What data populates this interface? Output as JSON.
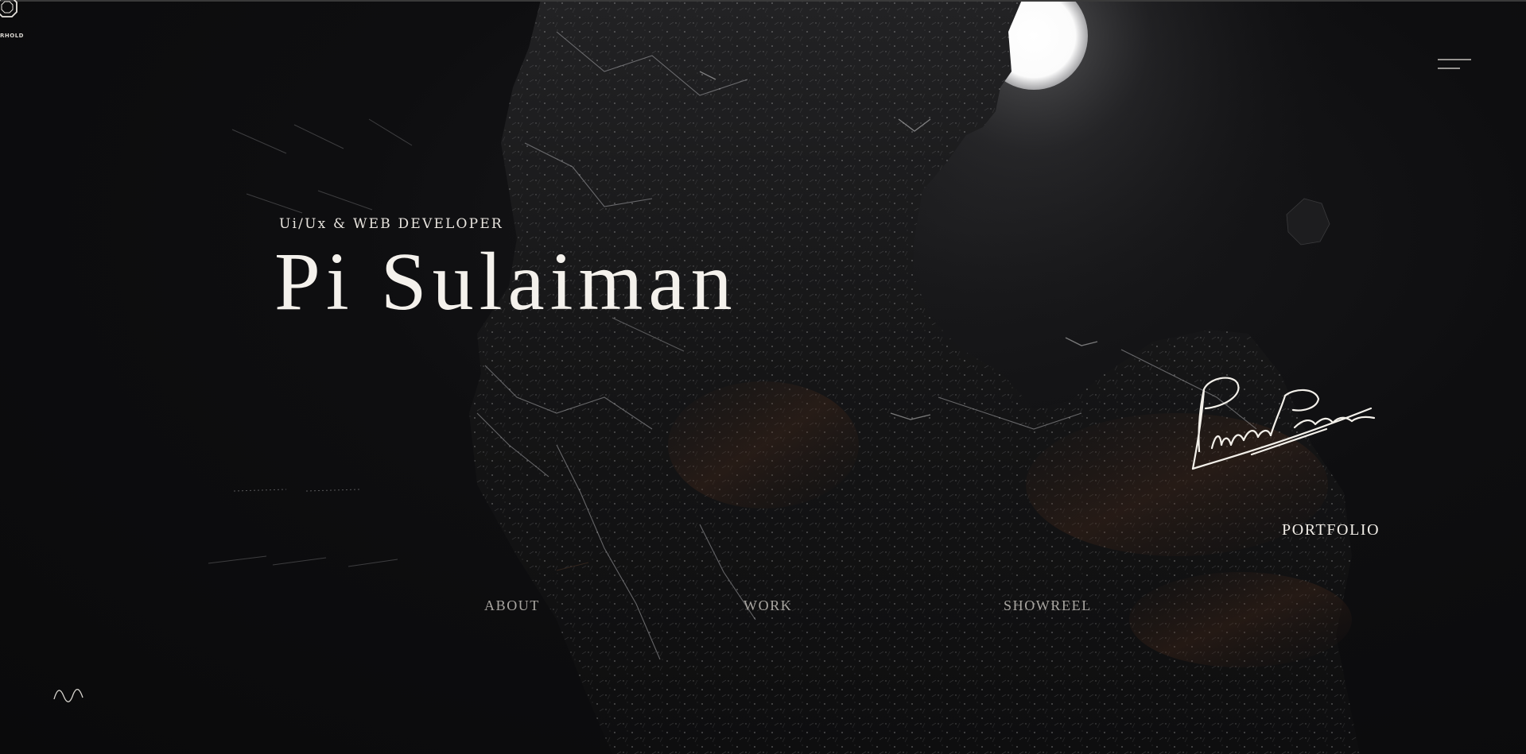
{
  "brand": {
    "logo_text": "RHOLD",
    "logo_icon": "octagon-logo-icon"
  },
  "header": {
    "menu_icon": "hamburger-menu-icon"
  },
  "hero": {
    "subtitle": "Ui/Ux & WEB DEVELOPER",
    "name": "Pi Sulaiman",
    "signature_icon": "signature-image"
  },
  "links": {
    "portfolio": "PORTFOLIO"
  },
  "nav": {
    "items": [
      {
        "label": "ABOUT"
      },
      {
        "label": "WORK"
      },
      {
        "label": "SHOWREEL"
      }
    ]
  },
  "footer": {
    "sound_icon": "sound-wave-icon"
  },
  "colors": {
    "background": "#0b0b0c",
    "text_primary": "#f4f1ec",
    "text_muted": "#a9a6a1",
    "moon_glow": "#ffffff"
  }
}
